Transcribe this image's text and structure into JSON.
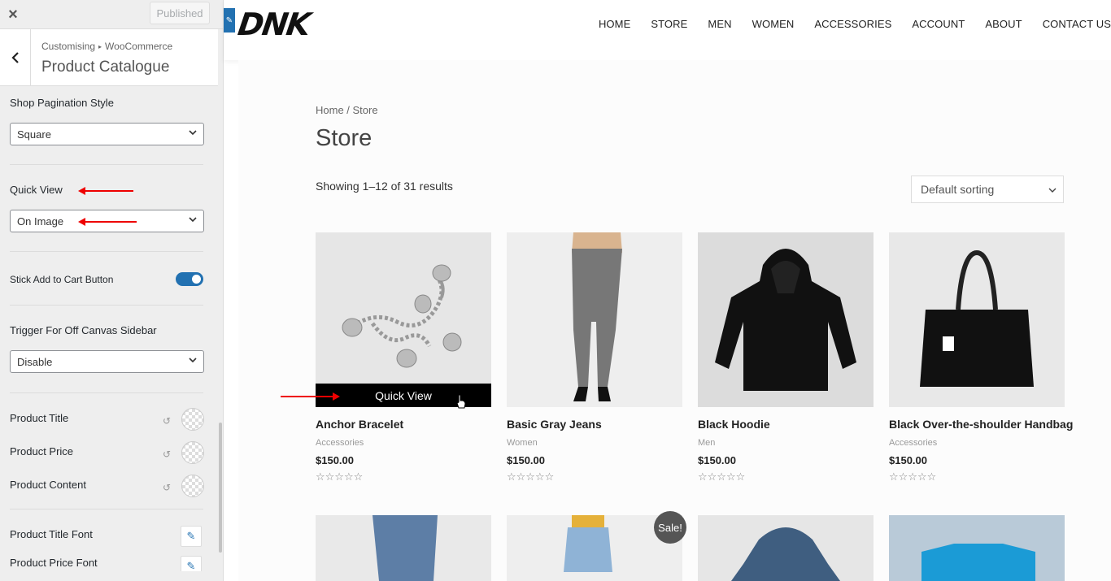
{
  "sidebar": {
    "close_label": "×",
    "published_label": "Published",
    "breadcrumb_root": "Customising",
    "breadcrumb_separator": "▸",
    "breadcrumb_parent": "WooCommerce",
    "section_title": "Product Catalogue",
    "pagination_label": "Shop Pagination Style",
    "pagination_value": "Square",
    "quick_view_label": "Quick View",
    "quick_view_value": "On Image",
    "stick_cart_label": "Stick Add to Cart Button",
    "stick_cart_enabled": true,
    "trigger_label": "Trigger For Off Canvas Sidebar",
    "trigger_value": "Disable",
    "colors": [
      {
        "label": "Product Title"
      },
      {
        "label": "Product Price"
      },
      {
        "label": "Product Content"
      }
    ],
    "fonts": [
      {
        "label": "Product Title Font"
      },
      {
        "label": "Product Price Font"
      }
    ]
  },
  "site": {
    "logo": "DNK",
    "nav": [
      "HOME",
      "STORE",
      "MEN",
      "WOMEN",
      "ACCESSORIES",
      "ACCOUNT",
      "ABOUT",
      "CONTACT US"
    ]
  },
  "shop": {
    "breadcrumb": "Home / Store",
    "title": "Store",
    "result_count": "Showing 1–12 of 31 results",
    "sorting": "Default sorting",
    "quick_view_label": "Quick View",
    "stars": "☆☆☆☆☆",
    "sale_label": "Sale!",
    "products": [
      {
        "name": "Anchor Bracelet",
        "category": "Accessories",
        "price": "$150.00"
      },
      {
        "name": "Basic Gray Jeans",
        "category": "Women",
        "price": "$150.00"
      },
      {
        "name": "Black Hoodie",
        "category": "Men",
        "price": "$150.00"
      },
      {
        "name": "Black Over-the-shoulder Handbag",
        "category": "Accessories",
        "price": "$150.00"
      }
    ]
  },
  "colors": {
    "accent": "#2271b1",
    "annotation_arrow": "#ee0000",
    "quick_view_bg": "#000000"
  }
}
